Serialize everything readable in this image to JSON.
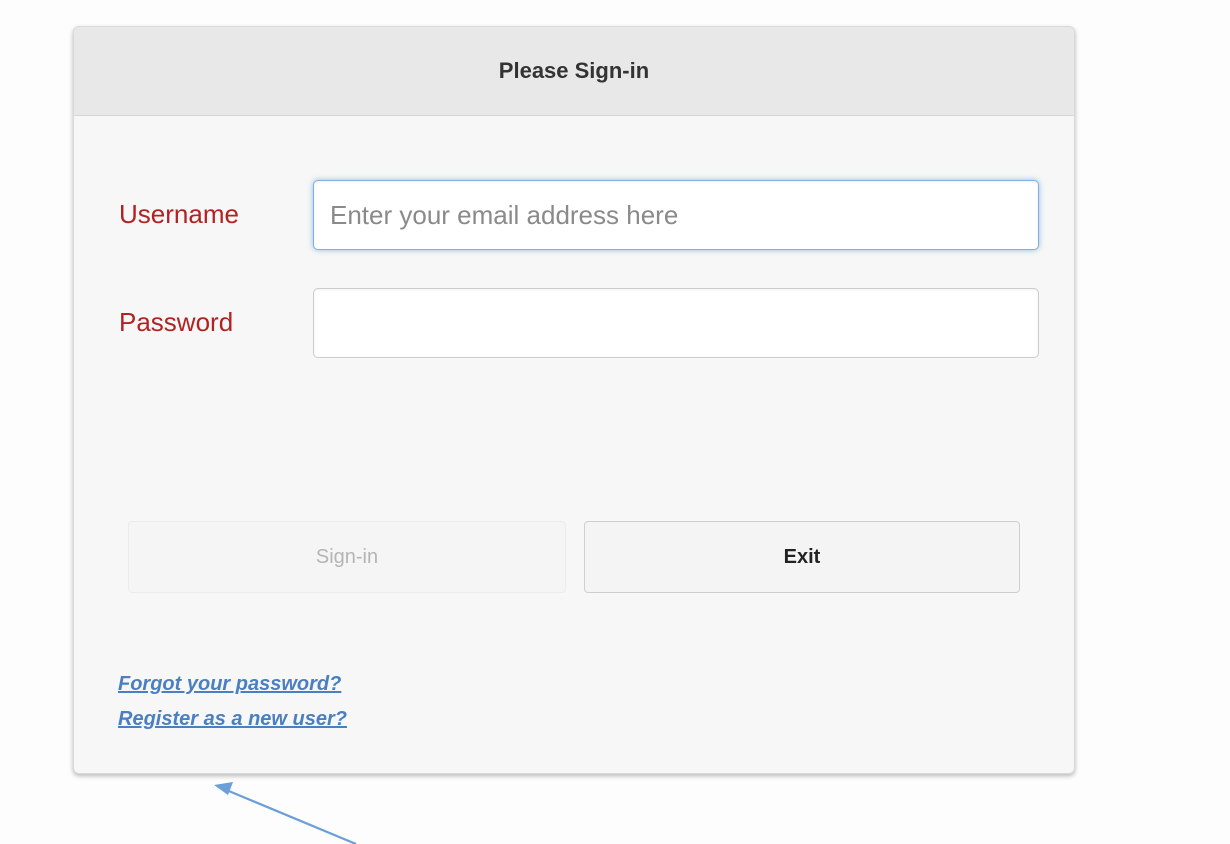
{
  "header": {
    "title": "Please Sign-in"
  },
  "form": {
    "username": {
      "label": "Username",
      "value": "",
      "placeholder": "Enter your email address here"
    },
    "password": {
      "label": "Password",
      "value": "",
      "placeholder": ""
    }
  },
  "buttons": {
    "signin_label": "Sign-in",
    "exit_label": "Exit"
  },
  "links": {
    "forgot_password": "Forgot your password?",
    "register": "Register as a new user?"
  },
  "colors": {
    "label_color": "#b22222",
    "link_color": "#4a7fc1",
    "header_background": "#e8e8e8",
    "focus_glow": "#7fb2e0",
    "annotation_arrow": "#6a9fd8"
  },
  "annotation": {
    "icon": "arrow-icon"
  }
}
